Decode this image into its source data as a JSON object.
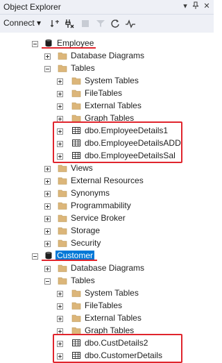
{
  "window": {
    "title": "Object Explorer"
  },
  "toolbar": {
    "connect_label": "Connect ▾"
  },
  "tree": {
    "items": [
      {
        "label": "Employee",
        "type": "database",
        "depth": 0,
        "expanded": true,
        "selected": false
      },
      {
        "label": "Database Diagrams",
        "type": "folder",
        "depth": 1,
        "expanded": false
      },
      {
        "label": "Tables",
        "type": "folder",
        "depth": 1,
        "expanded": true
      },
      {
        "label": "System Tables",
        "type": "folder",
        "depth": 2,
        "expanded": false
      },
      {
        "label": "FileTables",
        "type": "folder",
        "depth": 2,
        "expanded": false
      },
      {
        "label": "External Tables",
        "type": "folder",
        "depth": 2,
        "expanded": false
      },
      {
        "label": "Graph Tables",
        "type": "folder",
        "depth": 2,
        "expanded": false
      },
      {
        "label": "dbo.EmployeeDetails1",
        "type": "table",
        "depth": 2,
        "expanded": false
      },
      {
        "label": "dbo.EmployeeDetailsADD",
        "type": "table",
        "depth": 2,
        "expanded": false
      },
      {
        "label": "dbo.EmployeeDetailsSal",
        "type": "table",
        "depth": 2,
        "expanded": false
      },
      {
        "label": "Views",
        "type": "folder",
        "depth": 1,
        "expanded": false
      },
      {
        "label": "External Resources",
        "type": "folder",
        "depth": 1,
        "expanded": false
      },
      {
        "label": "Synonyms",
        "type": "folder",
        "depth": 1,
        "expanded": false
      },
      {
        "label": "Programmability",
        "type": "folder",
        "depth": 1,
        "expanded": false
      },
      {
        "label": "Service Broker",
        "type": "folder",
        "depth": 1,
        "expanded": false
      },
      {
        "label": "Storage",
        "type": "folder",
        "depth": 1,
        "expanded": false
      },
      {
        "label": "Security",
        "type": "folder",
        "depth": 1,
        "expanded": false
      },
      {
        "label": "Customer",
        "type": "database",
        "depth": 0,
        "expanded": true,
        "selected": true
      },
      {
        "label": "Database Diagrams",
        "type": "folder",
        "depth": 1,
        "expanded": false
      },
      {
        "label": "Tables",
        "type": "folder",
        "depth": 1,
        "expanded": true
      },
      {
        "label": "System Tables",
        "type": "folder",
        "depth": 2,
        "expanded": false
      },
      {
        "label": "FileTables",
        "type": "folder",
        "depth": 2,
        "expanded": false
      },
      {
        "label": "External Tables",
        "type": "folder",
        "depth": 2,
        "expanded": false
      },
      {
        "label": "Graph Tables",
        "type": "folder",
        "depth": 2,
        "expanded": false
      },
      {
        "label": "dbo.CustDetails2",
        "type": "table",
        "depth": 2,
        "expanded": false
      },
      {
        "label": "dbo.CustomerDetails",
        "type": "table",
        "depth": 2,
        "expanded": false
      }
    ]
  },
  "colors": {
    "accent_red": "#e0242c",
    "selection_blue": "#0078d7",
    "folder_yellow": "#dcb67a"
  }
}
